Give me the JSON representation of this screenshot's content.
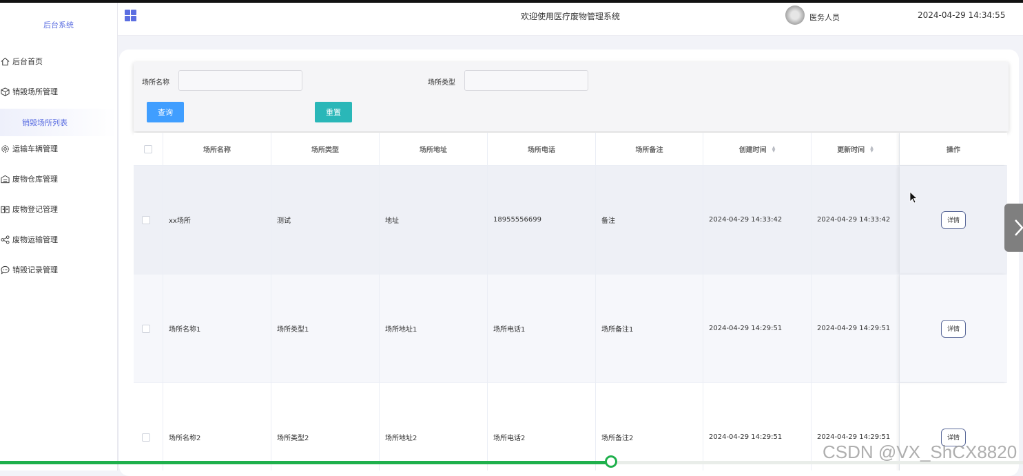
{
  "sidebar": {
    "brand": "后台系统",
    "items": [
      {
        "label": "后台首页",
        "icon": "home-icon"
      },
      {
        "label": "销毁场所管理",
        "icon": "cube-icon"
      },
      {
        "label": "运输车辆管理",
        "icon": "gear-icon"
      },
      {
        "label": "废物仓库管理",
        "icon": "warehouse-icon"
      },
      {
        "label": "废物登记管理",
        "icon": "book-icon"
      },
      {
        "label": "废物运输管理",
        "icon": "share-icon"
      },
      {
        "label": "销毁记录管理",
        "icon": "chat-icon"
      }
    ],
    "active_sub": "销毁场所列表"
  },
  "header": {
    "welcome": "欢迎使用医疗废物管理系统",
    "user": "医务人员",
    "datetime": "2024-04-29 14:34:55"
  },
  "search": {
    "name_label": "场所名称",
    "type_label": "场所类型",
    "name_value": "",
    "type_value": "",
    "query_button": "查询",
    "reset_button": "重置"
  },
  "table": {
    "columns": [
      "场所名称",
      "场所类型",
      "场所地址",
      "场所电话",
      "场所备注",
      "创建时间",
      "更新时间",
      "操作"
    ],
    "rows": [
      {
        "name": "xx场所",
        "type": "测试",
        "address": "地址",
        "phone": "18955556699",
        "remark": "备注",
        "created": "2024-04-29 14:33:42",
        "updated": "2024-04-29 14:33:42",
        "action": "详情"
      },
      {
        "name": "场所名称1",
        "type": "场所类型1",
        "address": "场所地址1",
        "phone": "场所电话1",
        "remark": "场所备注1",
        "created": "2024-04-29 14:29:51",
        "updated": "2024-04-29 14:29:51",
        "action": "详情"
      },
      {
        "name": "场所名称2",
        "type": "场所类型2",
        "address": "场所地址2",
        "phone": "场所电话2",
        "remark": "场所备注2",
        "created": "2024-04-29 14:29:51",
        "updated": "2024-04-29 14:29:51",
        "action": "详情"
      }
    ]
  },
  "video_progress": 0.597,
  "watermark": "CSDN @VX_ShCX8820",
  "colors": {
    "accent": "#5b6ee1",
    "query": "#409eff",
    "reset": "#2ab7b8",
    "progress": "#1fb04c"
  }
}
